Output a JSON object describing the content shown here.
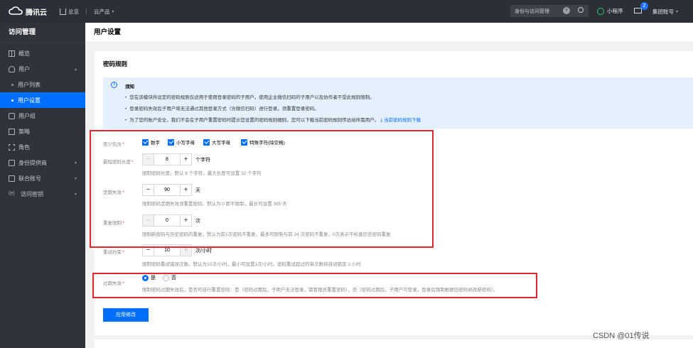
{
  "topbar": {
    "brand": "腾讯云",
    "home": "总览",
    "products": "云产品",
    "search_text": "身份与访问管理",
    "mini_program": "小程序",
    "mail_badge": "2",
    "account": "集团账号"
  },
  "sidebar": {
    "title": "访问管理",
    "items": [
      {
        "label": "概览"
      },
      {
        "label": "用户"
      },
      {
        "label": "用户列表"
      },
      {
        "label": "用户设置"
      },
      {
        "label": "用户组"
      },
      {
        "label": "策略"
      },
      {
        "label": "角色"
      },
      {
        "label": "身份提供商"
      },
      {
        "label": "联合账号"
      },
      {
        "label": "访问密钥"
      }
    ],
    "key_icon_text": "(e)"
  },
  "page": {
    "title": "用户设置",
    "section_title": "密码规则",
    "notice": {
      "title": "须知",
      "lines": [
        "您在该模块所设定的密码规则仅适用于使用登录密码的子用户。使用企业微信扫码的子用户以及协作者不受此规则限制。",
        "登录密码失效后子用户将无法通过其他登录方式（含微信扫码）进行登录，须重置登录密码。",
        "为了您的账户安全，我们不会在子用户重置密码时提示您设置的密码规则细则，您可以下载当前密码规则传达给所需用户。"
      ],
      "download": "当前密码规则下载"
    },
    "rules": {
      "contains": {
        "label": "至少包含",
        "options": [
          "数字",
          "小写字母",
          "大写字母",
          "特殊字符(除空格)"
        ]
      },
      "min_length": {
        "label": "最短密码长度",
        "value": "8",
        "unit": "个字符",
        "hint": "限制密码长度。默认 8 个字符，最大长度可设置 32 个字符"
      },
      "expire": {
        "label": "定期失效",
        "value": "90",
        "unit": "天",
        "hint": "限制密码定期失效须重置密码。默认为 0 即不限制，最长可设置 365 天"
      },
      "reuse": {
        "label": "重复限制",
        "value": "0",
        "unit": "次",
        "hint": "限制新密码与历史密码的重复。默认为前1次密码不重复，最多可限制与前 24 次密码不重复，0次表示不检查历史密码重复"
      },
      "retry": {
        "label": "重试约束",
        "value": "10",
        "unit": "次/小时",
        "hint": "限制密码重试错误次数。默认为10次/小时，最小可设置1次/小时。密码重试超过的单次数将自动锁定 1 小时"
      },
      "after_expire": {
        "label": "过期失效",
        "options": [
          "是",
          "否"
        ],
        "selected": "是",
        "hint": "限制密码过期失效后，是否可自行重置密码：是（密码过期后，子用户无法登录，需管理员重置密码），否（密码过期后，子用户可登录，登录后强制根据旧密码修改新密码）。"
      }
    },
    "apply_button": "应用修改"
  },
  "watermark": "CSDN @01传说",
  "colors": {
    "accent": "#006eff",
    "highlight": "#e0282e",
    "topbar": "#2b2f36",
    "sidebar": "#2f343c"
  }
}
